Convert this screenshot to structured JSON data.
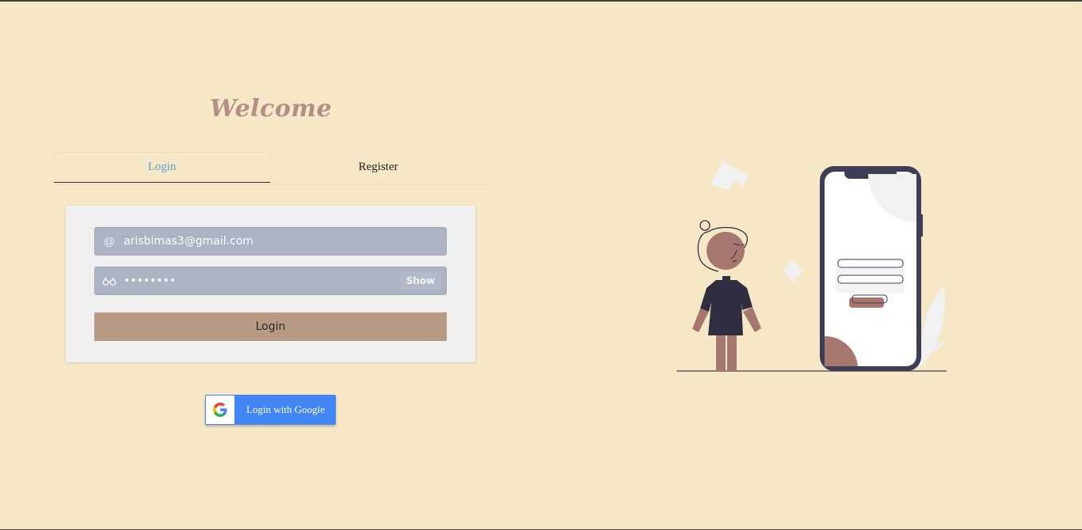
{
  "header": {
    "title": "Welcome"
  },
  "tabs": [
    {
      "label": "Login",
      "active": true
    },
    {
      "label": "Register",
      "active": false
    }
  ],
  "form": {
    "email": {
      "value": "arisbimas3@gmail.com",
      "icon": "at-icon"
    },
    "password": {
      "value": "••••••••",
      "icon": "glasses-icon",
      "show_label": "Show"
    },
    "submit_label": "Login"
  },
  "google": {
    "label": "Login with Google",
    "icon": "google-logo-icon"
  },
  "colors": {
    "background": "#f6e8c6",
    "accent_tab": "#5aa4d8",
    "field_bg": "#adb3c3",
    "button_bg": "#b89a84",
    "google_blue": "#4285f4",
    "title": "#b38e88"
  }
}
